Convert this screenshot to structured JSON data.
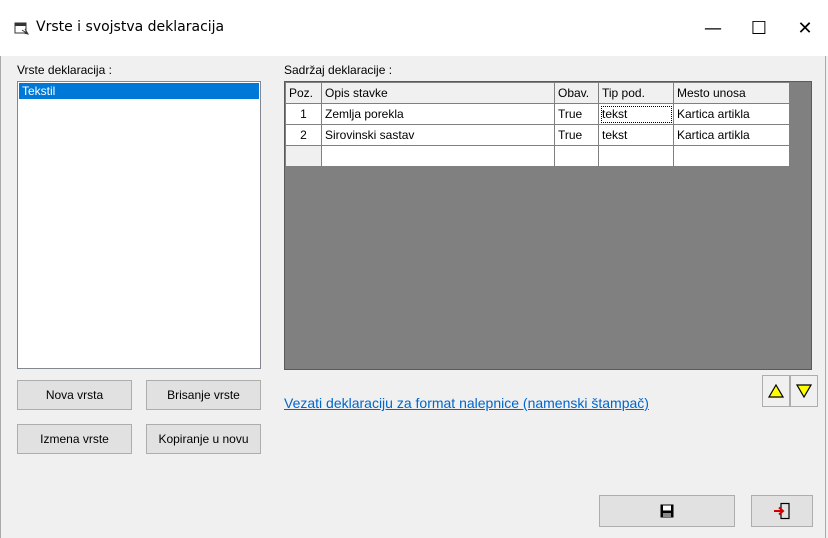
{
  "window": {
    "title": "Vrste i svojstva deklaracija",
    "minimize_glyph": "—",
    "maximize_glyph": "☐",
    "close_glyph": "✕"
  },
  "left": {
    "label": "Vrste deklaracija :",
    "items": [
      "Tekstil"
    ],
    "selected_index": 0
  },
  "right": {
    "label": "Sadržaj deklaracije :",
    "columns": [
      "Poz.",
      "Opis stavke",
      "Obav.",
      "Tip pod.",
      "Mesto unosa"
    ],
    "rows": [
      [
        "1",
        "Zemlja porekla",
        "True",
        "tekst",
        "Kartica artikla"
      ],
      [
        "2",
        "Sirovinski sastav",
        "True",
        "tekst",
        "Kartica artikla"
      ]
    ]
  },
  "buttons": {
    "new_type": "Nova vrsta",
    "delete_type": "Brisanje vrste",
    "edit_type": "Izmena vrste",
    "copy_new": "Kopiranje u novu"
  },
  "link_text": "Vezati deklaraciju za format nalepnice (namenski štampač)",
  "icons": {
    "title": "form-icon",
    "up": "triangle-up-icon",
    "down": "triangle-down-icon",
    "save": "floppy-disk-icon",
    "exit": "exit-door-icon"
  },
  "colors": {
    "selection": "#0078d7",
    "link": "#0066cc",
    "grid_background": "#808080",
    "arrow_fill": "#ffff00"
  }
}
